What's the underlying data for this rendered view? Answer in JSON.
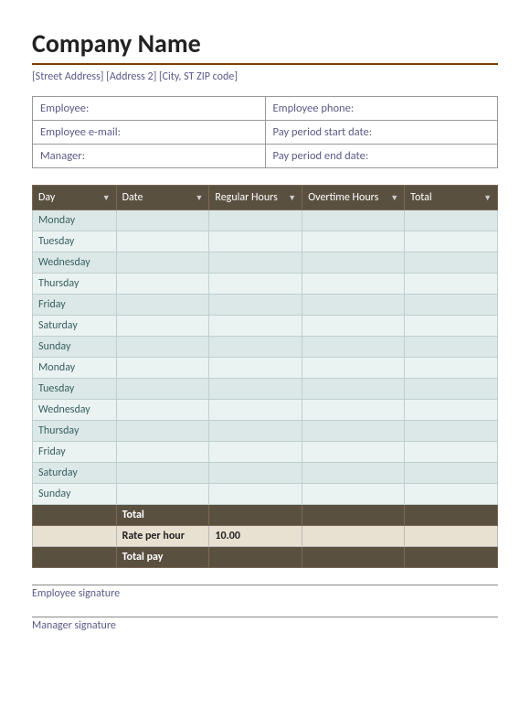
{
  "header": {
    "company_name": "Company Name",
    "address": "[Street Address] [Address 2] [City, ST ZIP code]"
  },
  "info_fields": {
    "employee_label": "Employee:",
    "phone_label": "Employee phone:",
    "email_label": "Employee e-mail:",
    "pay_start_label": "Pay period start date:",
    "manager_label": "Manager:",
    "pay_end_label": "Pay period end date:"
  },
  "table": {
    "columns": {
      "day": "Day",
      "date": "Date",
      "regular_hours": "Regular Hours",
      "overtime_hours": "Overtime Hours",
      "total": "Total"
    },
    "rows": [
      {
        "day": "Monday",
        "date": "",
        "regular": "",
        "overtime": "",
        "total": ""
      },
      {
        "day": "Tuesday",
        "date": "",
        "regular": "",
        "overtime": "",
        "total": ""
      },
      {
        "day": "Wednesday",
        "date": "",
        "regular": "",
        "overtime": "",
        "total": ""
      },
      {
        "day": "Thursday",
        "date": "",
        "regular": "",
        "overtime": "",
        "total": ""
      },
      {
        "day": "Friday",
        "date": "",
        "regular": "",
        "overtime": "",
        "total": ""
      },
      {
        "day": "Saturday",
        "date": "",
        "regular": "",
        "overtime": "",
        "total": ""
      },
      {
        "day": "Sunday",
        "date": "",
        "regular": "",
        "overtime": "",
        "total": ""
      },
      {
        "day": "Monday",
        "date": "",
        "regular": "",
        "overtime": "",
        "total": ""
      },
      {
        "day": "Tuesday",
        "date": "",
        "regular": "",
        "overtime": "",
        "total": ""
      },
      {
        "day": "Wednesday",
        "date": "",
        "regular": "",
        "overtime": "",
        "total": ""
      },
      {
        "day": "Thursday",
        "date": "",
        "regular": "",
        "overtime": "",
        "total": ""
      },
      {
        "day": "Friday",
        "date": "",
        "regular": "",
        "overtime": "",
        "total": ""
      },
      {
        "day": "Saturday",
        "date": "",
        "regular": "",
        "overtime": "",
        "total": ""
      },
      {
        "day": "Sunday",
        "date": "",
        "regular": "",
        "overtime": "",
        "total": ""
      }
    ],
    "total_row": {
      "label": "Total"
    },
    "rate_row": {
      "label": "Rate per hour",
      "value": "10.00"
    },
    "totalpay_row": {
      "label": "Total pay"
    }
  },
  "signatures": {
    "employee_label": "Employee signature",
    "manager_label": "Manager signature"
  }
}
